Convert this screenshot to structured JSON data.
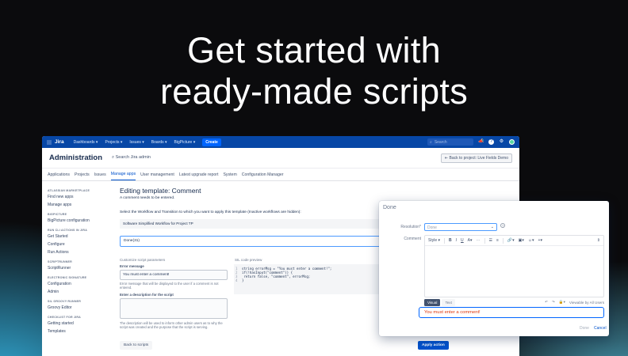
{
  "headline": {
    "line1": "Get started with",
    "line2": "ready-made scripts"
  },
  "topbar": {
    "logo": "Jira",
    "nav": [
      "Dashboards ▾",
      "Projects ▾",
      "Issues ▾",
      "Boards ▾",
      "BigPicture ▾"
    ],
    "create": "Create",
    "search_placeholder": "Search"
  },
  "admin": {
    "title": "Administration",
    "search": "Search Jira admin",
    "back_button": "Back to project: Live Fields Demo"
  },
  "tabs": [
    "Applications",
    "Projects",
    "Issues",
    "Manage apps",
    "User management",
    "Latest upgrade report",
    "System",
    "Configuration Manager"
  ],
  "active_tab": "Manage apps",
  "sidebar": [
    {
      "section": "ATLASSIAN MARKETPLACE",
      "items": [
        "Find new apps",
        "Manage apps"
      ]
    },
    {
      "section": "BIGPICTURE",
      "items": [
        "BigPicture configuration"
      ]
    },
    {
      "section": "RUN CLI ACTIONS IN JIRA",
      "items": [
        "Get Started",
        "Configure",
        "Run Actions"
      ]
    },
    {
      "section": "SCRIPTRUNNER",
      "items": [
        "ScriptRunner"
      ]
    },
    {
      "section": "ELECTRONIC SIGNATURE",
      "items": [
        "Configuration",
        "Admin"
      ]
    },
    {
      "section": "SIL GROOVY RUNNER",
      "items": [
        "Groovy Editor"
      ]
    },
    {
      "section": "CHECKLIST FOR JIRA",
      "items": [
        "Getting started",
        "Templates"
      ]
    }
  ],
  "main": {
    "title": "Editing template: Comment",
    "subtitle": "A comment needs to be entered.",
    "instruction": "Select the Workflow and Transition to which you want to apply this template (Inactive workflows are hidden):",
    "workflow": "Software Simplified Workflow for Project TP",
    "transition": "Done(31)",
    "params_label": "Customize script parameters",
    "error_label": "Error message",
    "error_value": "You must enter a comment!",
    "error_help": "Error message that will be displayed to the user if a comment is not entered.",
    "desc_label": "Enter a description for the script",
    "desc_help": "The description will be used to inform other admin users as to why the script was created and the purpose that the script is serving.",
    "preview_label": "SIL code preview",
    "code_lines": [
      {
        "n": "1",
        "text": "string errorMsg = \"You must enter a comment!\";"
      },
      {
        "n": "2",
        "text": "if(!hasInput(\"comment\")) {"
      },
      {
        "n": "3",
        "text": "    return false, \"comment\", errorMsg;"
      },
      {
        "n": "4",
        "text": "}"
      }
    ],
    "back_button": "Back to scripts",
    "apply_button": "Apply action"
  },
  "dialog": {
    "title": "Done",
    "resolution_label": "Resolution*",
    "resolution_value": "Done",
    "comment_label": "Comment",
    "toolbar_style": "Style ▾",
    "visual_tab": "Visual",
    "text_tab": "Text",
    "viewable": "Viewable by All Users",
    "error_message": "You must enter a comment!",
    "done_button": "Done",
    "cancel_button": "Cancel"
  }
}
